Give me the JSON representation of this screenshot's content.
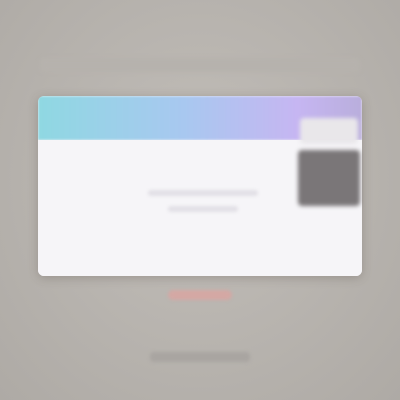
{
  "window": {
    "title": ""
  },
  "action": {
    "label": ""
  },
  "colors": {
    "background": "#b9b5b0",
    "window_body": "#f6f5f8",
    "header_gradient_start": "#8fd8e2",
    "header_gradient_mid": "#a8c8f0",
    "header_gradient_end": "#c6b6f2",
    "action_button": "#d4a8a4",
    "thumbnail": "#7a7678"
  }
}
